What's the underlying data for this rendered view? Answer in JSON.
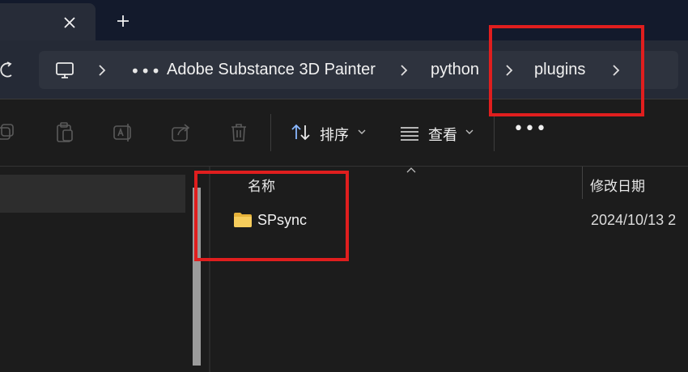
{
  "tabs": {
    "close_icon": "close-icon",
    "new_tab_icon": "plus-icon"
  },
  "address": {
    "more_label": "•••",
    "crumbs": [
      "Adobe Substance 3D Painter",
      "python",
      "plugins"
    ]
  },
  "toolbar": {
    "sort_label": "排序",
    "view_label": "查看",
    "more_label": "•••"
  },
  "columns": {
    "name": "名称",
    "modified": "修改日期"
  },
  "files": [
    {
      "name": "SPsync",
      "date": "2024/10/13 2",
      "type": "folder"
    }
  ],
  "colors": {
    "annotation": "#e01e1e",
    "folder": "#f0c24b",
    "accent": "#7ab4ff"
  }
}
